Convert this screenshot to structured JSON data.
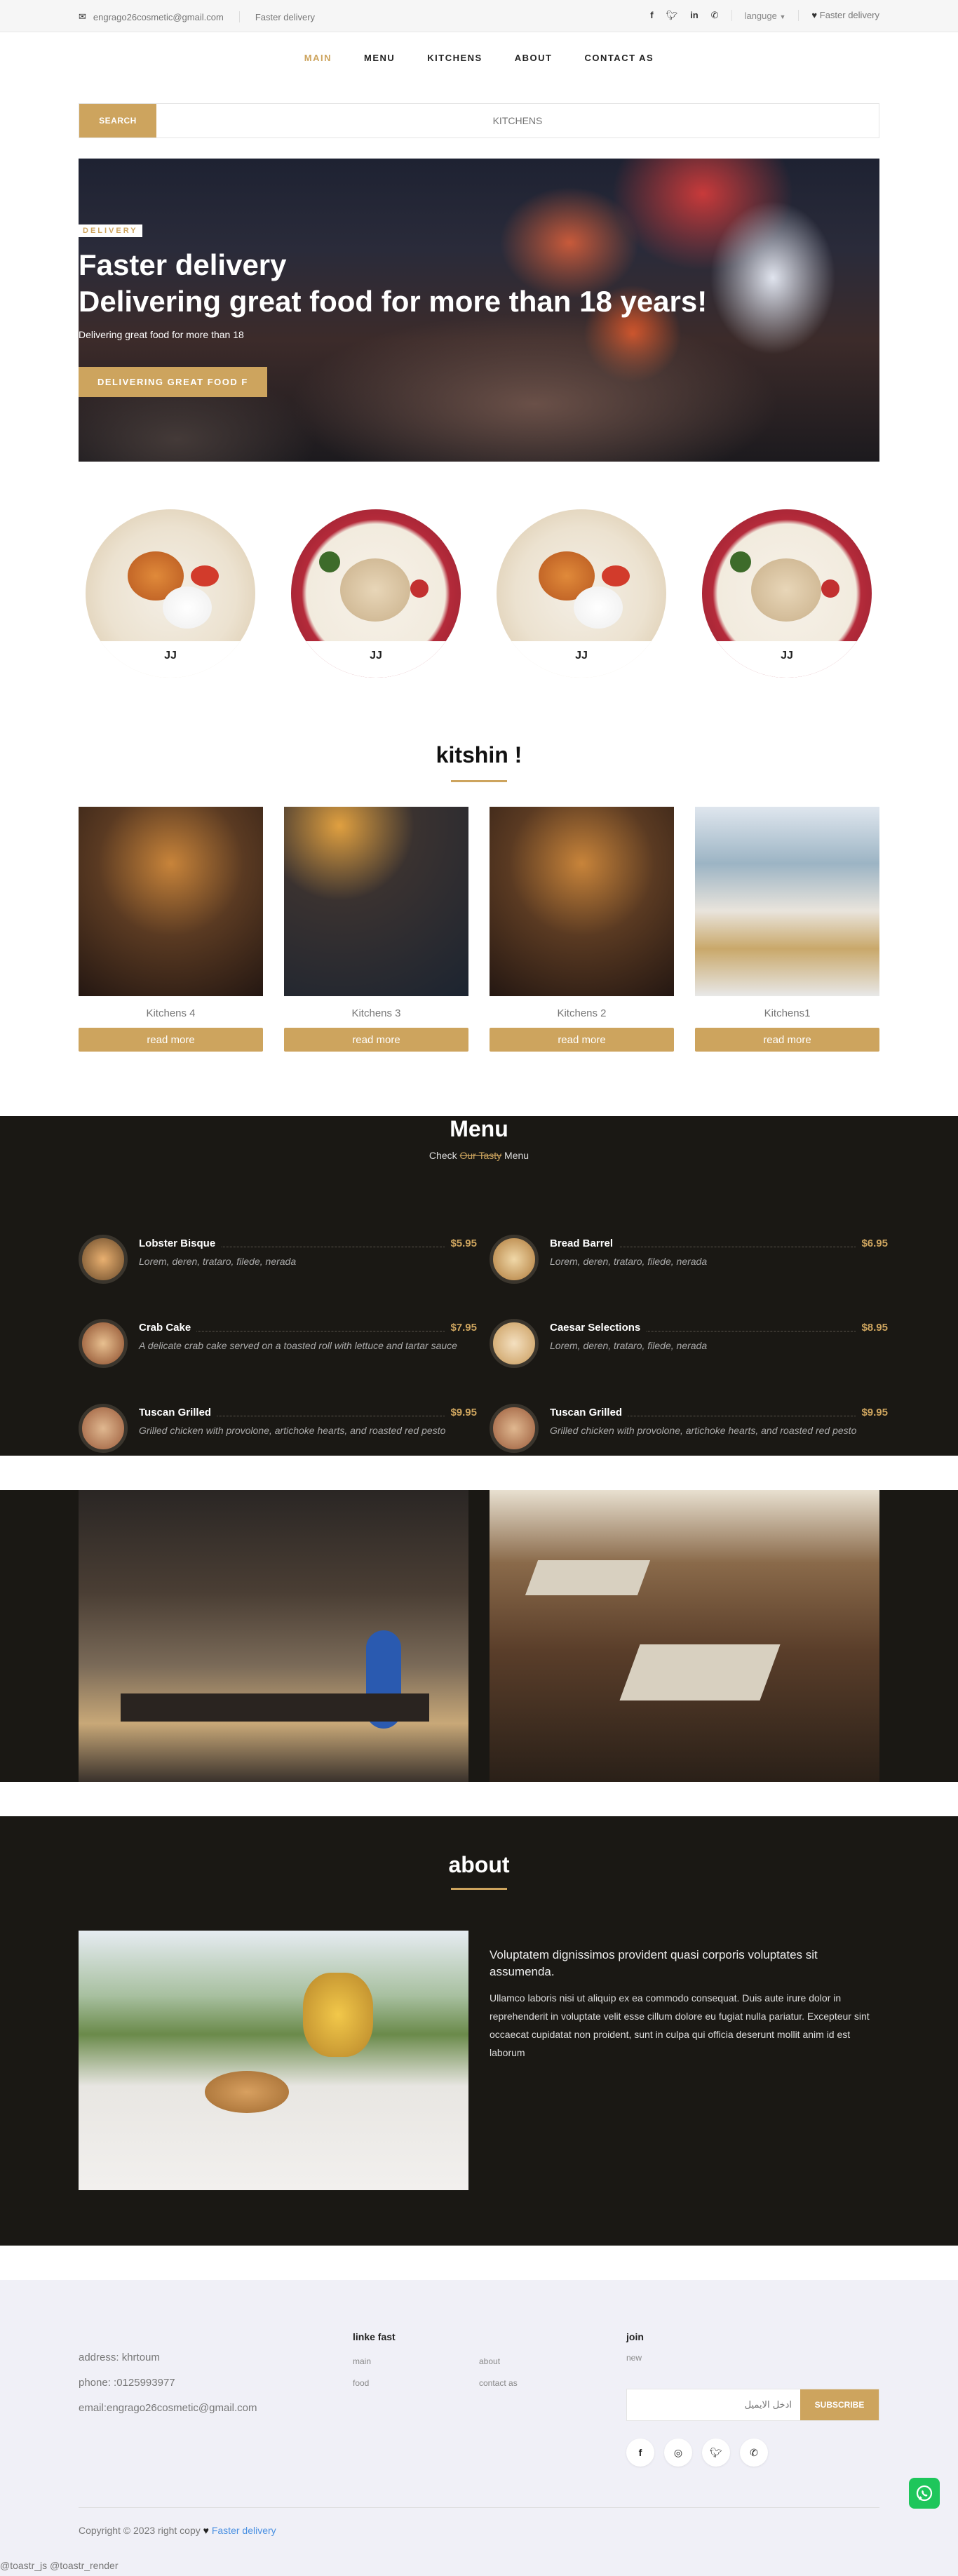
{
  "topbar": {
    "email": "engrago26cosmetic@gmail.com",
    "tagline": "Faster delivery",
    "social_icons": [
      "facebook-icon",
      "twitter-icon",
      "linkedin-icon",
      "whatsapp-icon"
    ],
    "language": "languge",
    "wish": "Faster delivery"
  },
  "nav": {
    "items": [
      "MAIN",
      "MENU",
      "KITCHENS",
      "ABOUT",
      "CONTACT AS"
    ],
    "active": "MAIN"
  },
  "search": {
    "button": "SEARCH",
    "placeholder": "KITCHENS"
  },
  "hero": {
    "tag": "DELIVERY",
    "title_line1": "Faster delivery",
    "title_line2": "Delivering great food for more than 18 years!",
    "subtitle": "Delivering great food for more than 18",
    "cta": "DELIVERING GREAT FOOD F"
  },
  "dishes": [
    {
      "label": "JJ"
    },
    {
      "label": "JJ"
    },
    {
      "label": "JJ"
    },
    {
      "label": "JJ"
    }
  ],
  "kitchens": {
    "title": "kitshin !",
    "cards": [
      {
        "name": "Kitchens 4",
        "button": "read more"
      },
      {
        "name": "Kitchens 3",
        "button": "read more"
      },
      {
        "name": "Kitchens 2",
        "button": "read more"
      },
      {
        "name": "Kitchens1",
        "button": "read more"
      }
    ]
  },
  "menu": {
    "title": "Menu",
    "sub_pre": "Check ",
    "sub_strike": "Our Tasty",
    "sub_post": " Menu",
    "items": [
      {
        "name": "Lobster Bisque",
        "price": "$5.95",
        "desc": "Lorem, deren, trataro, filede, nerada"
      },
      {
        "name": "Bread Barrel",
        "price": "$6.95",
        "desc": "Lorem, deren, trataro, filede, nerada"
      },
      {
        "name": "Crab Cake",
        "price": "$7.95",
        "desc": "A delicate crab cake served on a toasted roll with lettuce and tartar sauce"
      },
      {
        "name": "Caesar Selections",
        "price": "$8.95",
        "desc": "Lorem, deren, trataro, filede, nerada"
      },
      {
        "name": "Tuscan Grilled",
        "price": "$9.95",
        "desc": "Grilled chicken with provolone, artichoke hearts, and roasted red pesto"
      },
      {
        "name": "Tuscan Grilled",
        "price": "$9.95",
        "desc": "Grilled chicken with provolone, artichoke hearts, and roasted red pesto"
      }
    ]
  },
  "about": {
    "title": "about",
    "lead": "Voluptatem dignissimos provident quasi corporis voluptates sit assumenda.",
    "body": "Ullamco laboris nisi ut aliquip ex ea commodo consequat. Duis aute irure dolor in reprehenderit in voluptate velit esse cillum dolore eu fugiat nulla pariatur. Excepteur sint occaecat cupidatat non proident, sunt in culpa qui officia deserunt mollit anim id est laborum"
  },
  "footer": {
    "address": "address: khrtoum",
    "phone": "phone: :0125993977",
    "email": "email:engrago26cosmetic@gmail.com",
    "links_title": "linke fast",
    "links": [
      "main",
      "about",
      "food",
      "contact as"
    ],
    "join_title": "join",
    "join_sub": "new",
    "newsletter_placeholder": "ادخل الايميل",
    "subscribe": "SUBSCRIBE",
    "social_icons": [
      "facebook-icon",
      "instagram-icon",
      "twitter-icon",
      "whatsapp-icon"
    ],
    "copy_pre": "Copyright © 2023 right copy",
    "copy_brand": "Faster delivery"
  },
  "toastr_text": "@toastr_js @toastr_render",
  "colors": {
    "accent": "#cda45e",
    "dark": "#1a1814",
    "footer_bg": "#f0f0f7"
  }
}
